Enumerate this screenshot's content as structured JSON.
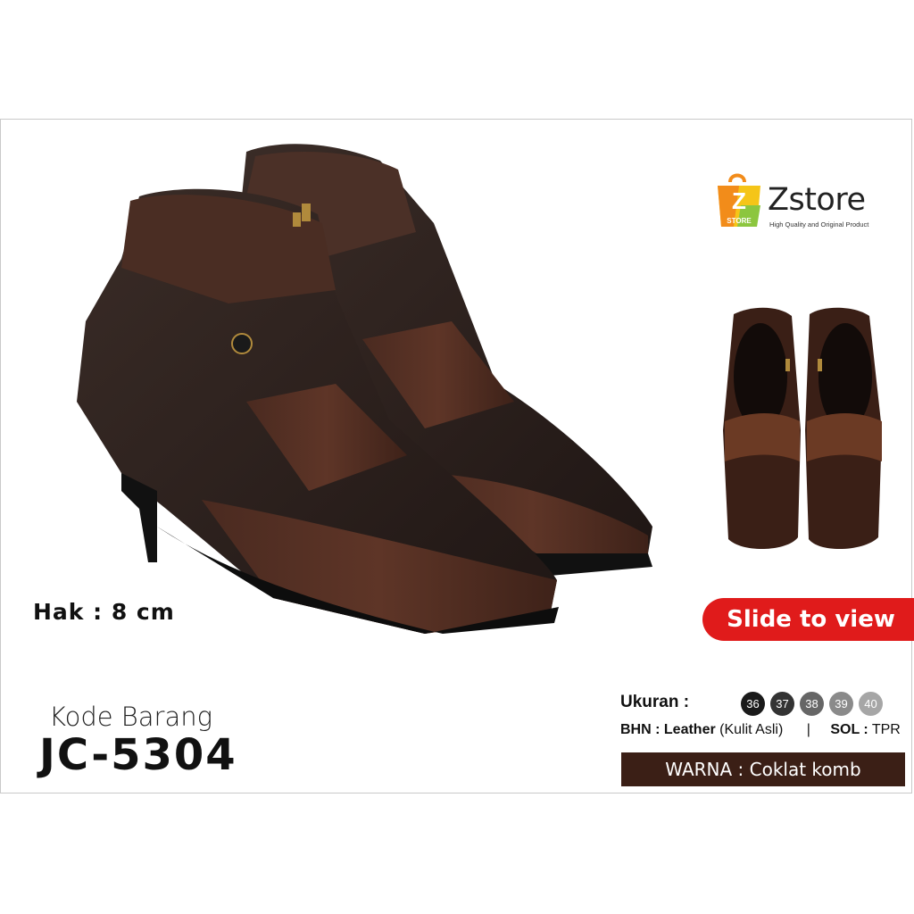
{
  "product": {
    "heel_label": "Hak : 8 cm",
    "code_label": "Kode Barang",
    "code": "JC-5304"
  },
  "brand": {
    "logo_letter": "Z",
    "logo_sub": "STORE",
    "name": "Zstore",
    "tagline": "High Quality and Original Product"
  },
  "actions": {
    "slide_label": "Slide to view"
  },
  "specs": {
    "size_label": "Ukuran :",
    "sizes": [
      {
        "label": "36",
        "color": "#1a1a1a"
      },
      {
        "label": "37",
        "color": "#333333"
      },
      {
        "label": "38",
        "color": "#666666"
      },
      {
        "label": "39",
        "color": "#8a8a8a"
      },
      {
        "label": "40",
        "color": "#a6a6a6"
      }
    ],
    "material_key": "BHN :",
    "material_value": "Leather",
    "material_note": "(Kulit Asli)",
    "separator": "|",
    "sole_key": "SOL :",
    "sole_value": "TPR",
    "color_label": "WARNA :  Coklat komb"
  },
  "colors": {
    "accent_red": "#e01b1b",
    "dark_brown": "#3b1f16",
    "logo_orange": "#f28c1a",
    "logo_yellow": "#f5c518",
    "logo_green": "#8cc63f"
  }
}
